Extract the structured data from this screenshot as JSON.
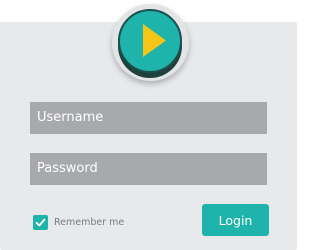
{
  "form": {
    "username_placeholder": "Username",
    "password_placeholder": "Password",
    "remember_label": "Remember me",
    "remember_checked": true,
    "login_label": "Login"
  },
  "icons": {
    "logo": "play-icon",
    "checkbox": "checkmark-icon"
  },
  "colors": {
    "accent": "#1fb4ab",
    "play": "#f5c518",
    "field": "#a7a9ac",
    "panel": "#e8e9eb"
  }
}
